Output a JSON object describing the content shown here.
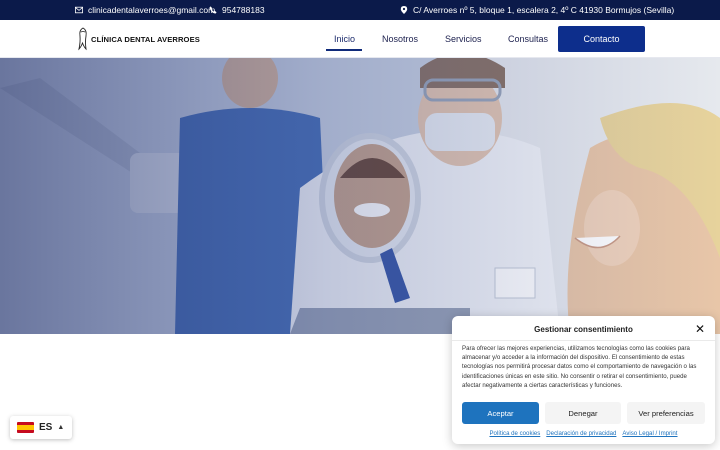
{
  "topbar": {
    "email": "clinicadentalaverroes@gmail.com",
    "phone": "954788183",
    "address": "C/ Averroes nº 5, bloque 1, escalera 2, 4º C 41930 Bormujos (Sevilla)",
    "icons": {
      "email": "envelope-icon",
      "phone": "phone-icon",
      "address": "map-pin-icon"
    }
  },
  "header": {
    "logo_text": "CLÍNICA DENTAL AVERROES",
    "nav": [
      "Inicio",
      "Nosotros",
      "Servicios",
      "Consultas"
    ],
    "active_nav": "Inicio",
    "contact_label": "Contacto",
    "accent_color": "#0d2e8c"
  },
  "language": {
    "code": "ES",
    "flag": "spain-flag-icon"
  },
  "cookie": {
    "title": "Gestionar consentimiento",
    "body": "Para ofrecer las mejores experiencias, utilizamos tecnologías como las cookies para almacenar y/o acceder a la información del dispositivo. El consentimiento de estas tecnologías nos permitirá procesar datos como el comportamiento de navegación o las identificaciones únicas en este sitio. No consentir o retirar el consentimiento, puede afectar negativamente a ciertas características y funciones.",
    "accept": "Aceptar",
    "deny": "Denegar",
    "preferences": "Ver preferencias",
    "links": [
      "Política de cookies",
      "Declaración de privacidad",
      "Aviso Legal / Imprint"
    ],
    "accept_color": "#1e73be"
  }
}
